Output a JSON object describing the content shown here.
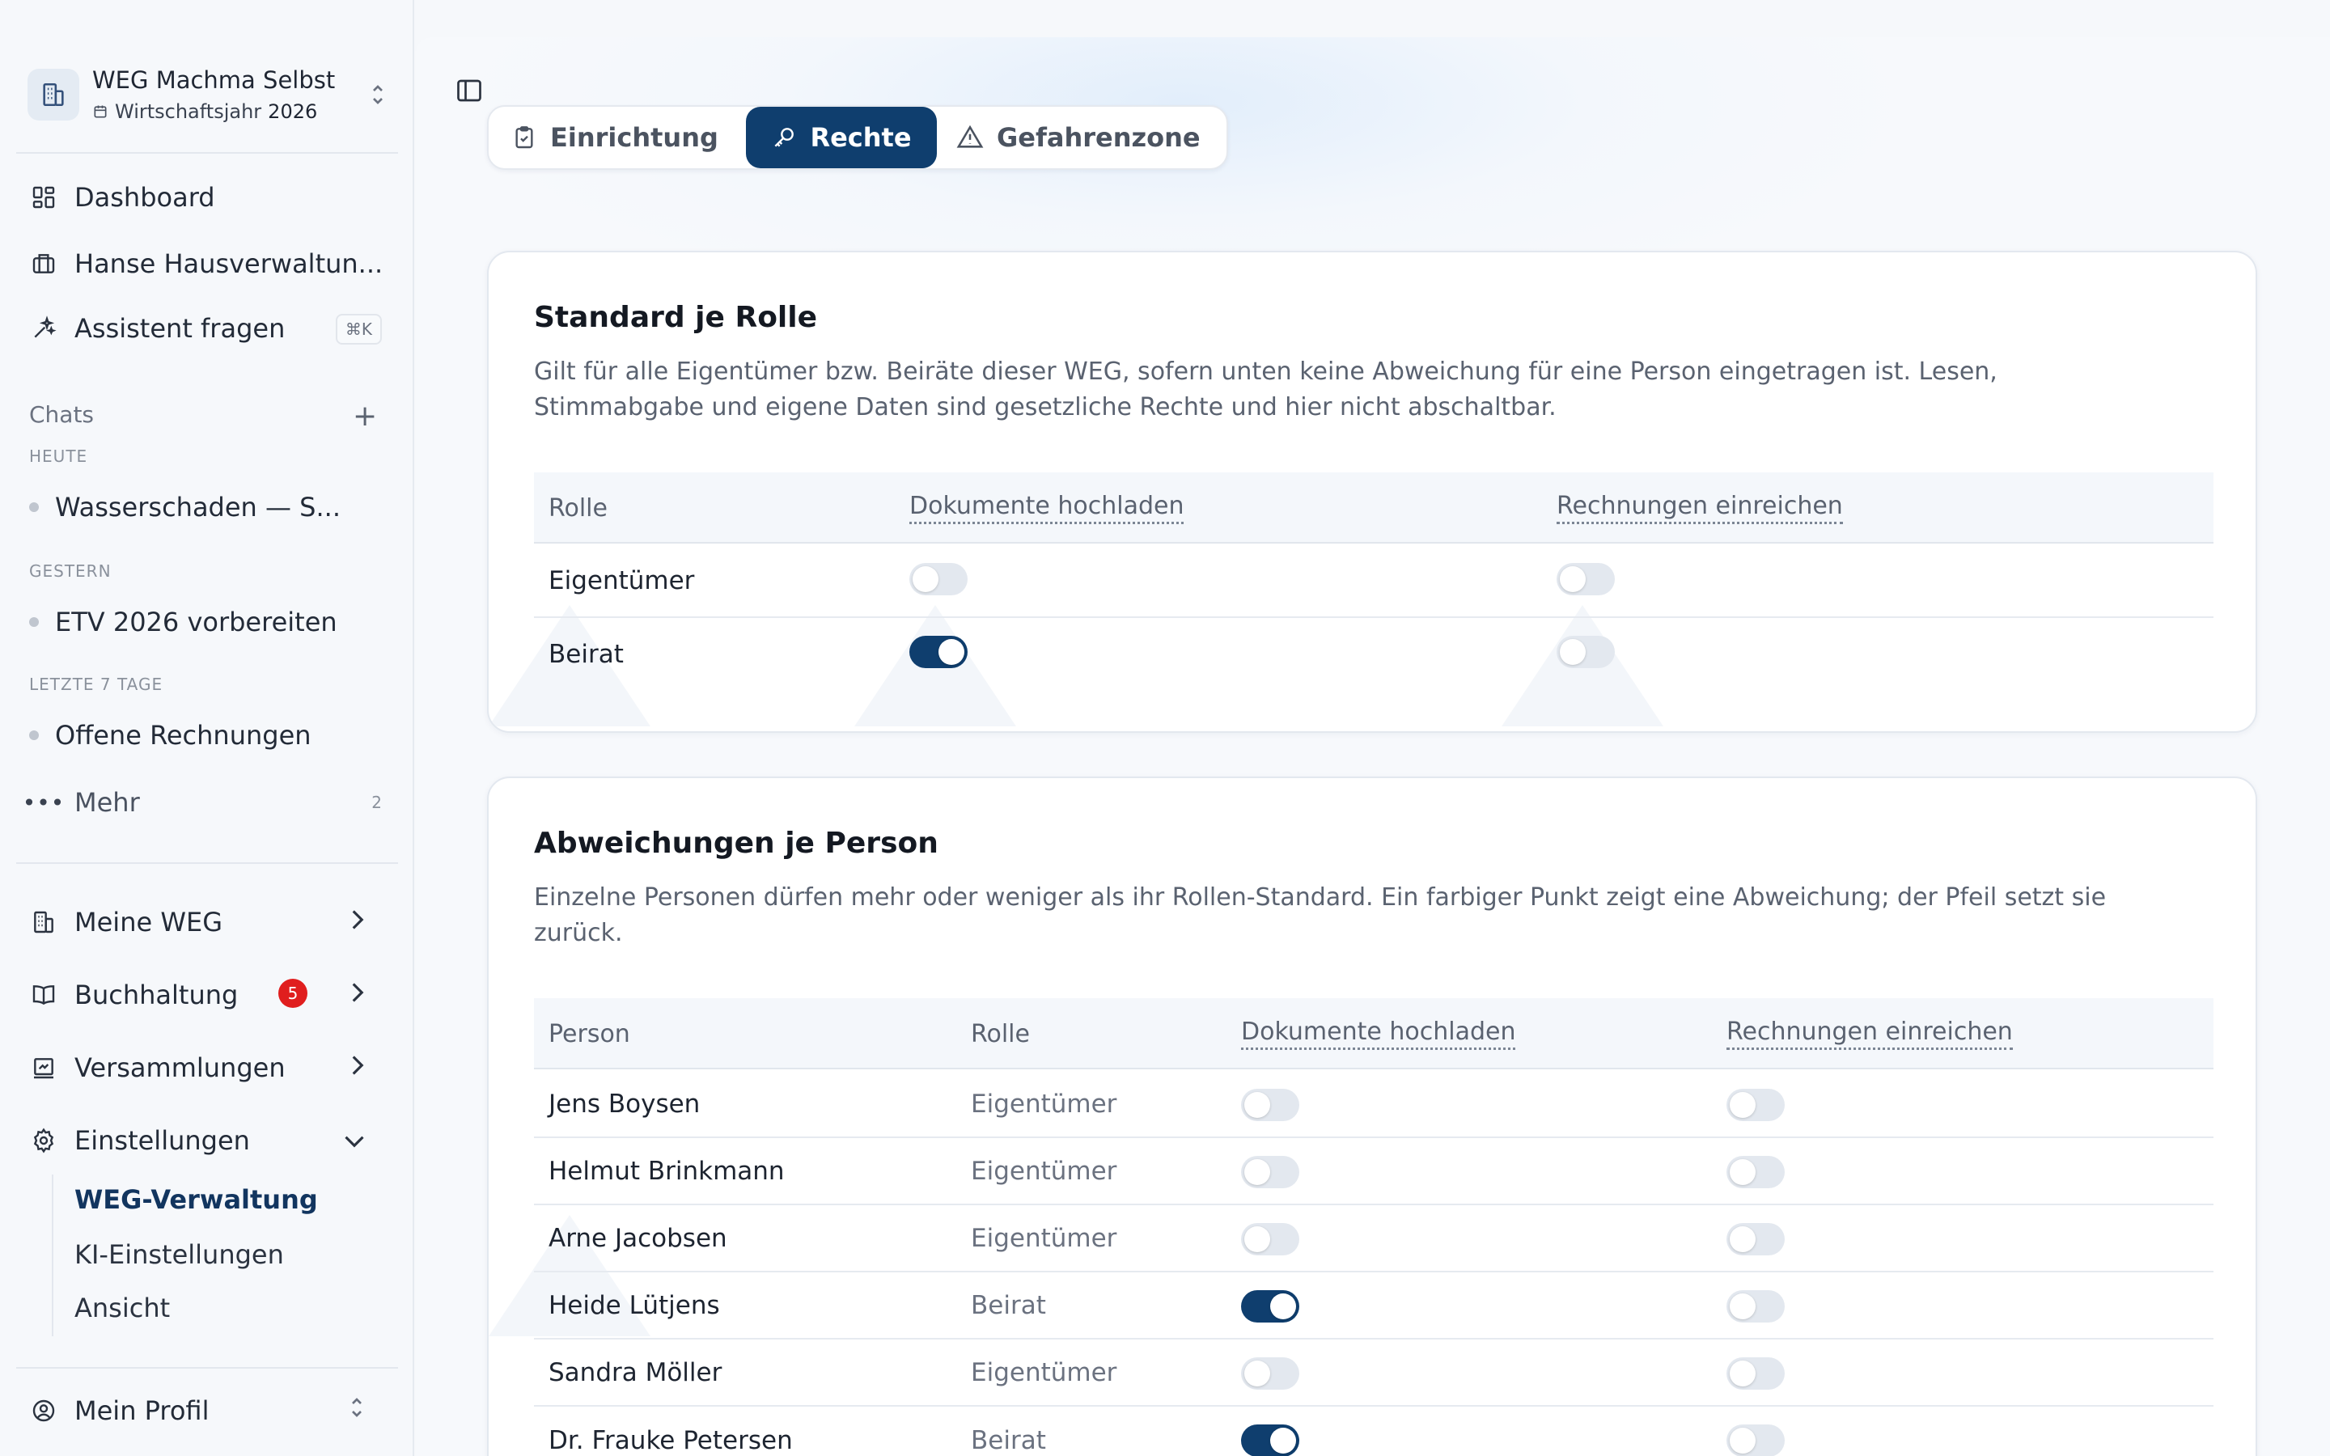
{
  "org": {
    "name": "WEG Machma Selbst",
    "year_label": "Wirtschaftsjahr",
    "year": "2026"
  },
  "nav": {
    "dashboard": "Dashboard",
    "hausverwaltung": "Hanse Hausverwaltun...",
    "assistant": "Assistent fragen",
    "assistant_shortcut": "⌘K"
  },
  "chats": {
    "label": "Chats",
    "today": "HEUTE",
    "yesterday": "GESTERN",
    "last7": "LETZTE 7 TAGE",
    "items": [
      "Wasserschaden — S...",
      "ETV 2026 vorbereiten",
      "Offene Rechnungen"
    ],
    "more": "Mehr",
    "more_count": "2"
  },
  "sections": {
    "meine_weg": "Meine WEG",
    "buchhaltung": "Buchhaltung",
    "buchhaltung_badge": "5",
    "versammlungen": "Versammlungen",
    "einstellungen": "Einstellungen",
    "sub": [
      "WEG-Verwaltung",
      "KI-Einstellungen",
      "Ansicht"
    ],
    "profile": "Mein Profil"
  },
  "tabs": [
    {
      "label": "Einrichtung",
      "active": false
    },
    {
      "label": "Rechte",
      "active": true
    },
    {
      "label": "Gefahrenzone",
      "active": false
    }
  ],
  "standard": {
    "title": "Standard je Rolle",
    "desc_line1": "Gilt für alle Eigentümer bzw. Beiräte dieser WEG, sofern unten keine Abweichung für eine Person eingetragen ist. Lesen,",
    "desc_line2": "Stimmabgabe und eigene Daten sind gesetzliche Rechte und hier nicht abschaltbar.",
    "headers": [
      "Rolle",
      "Dokumente hochladen",
      "Rechnungen einreichen"
    ],
    "rows": [
      {
        "role": "Eigentümer",
        "upload": false,
        "invoice": false
      },
      {
        "role": "Beirat",
        "upload": true,
        "invoice": false
      }
    ]
  },
  "persons": {
    "title": "Abweichungen je Person",
    "desc_line1": "Einzelne Personen dürfen mehr oder weniger als ihr Rollen-Standard. Ein farbiger Punkt zeigt eine Abweichung; der Pfeil setzt sie",
    "desc_line2": "zurück.",
    "headers": [
      "Person",
      "Rolle",
      "Dokumente hochladen",
      "Rechnungen einreichen"
    ],
    "rows": [
      {
        "name": "Jens Boysen",
        "role": "Eigentümer",
        "upload": false,
        "invoice": false
      },
      {
        "name": "Helmut Brinkmann",
        "role": "Eigentümer",
        "upload": false,
        "invoice": false
      },
      {
        "name": "Arne Jacobsen",
        "role": "Eigentümer",
        "upload": false,
        "invoice": false
      },
      {
        "name": "Heide Lütjens",
        "role": "Beirat",
        "upload": true,
        "invoice": false
      },
      {
        "name": "Sandra Möller",
        "role": "Eigentümer",
        "upload": false,
        "invoice": false
      },
      {
        "name": "Dr. Frauke Petersen",
        "role": "Beirat",
        "upload": true,
        "invoice": false
      }
    ]
  },
  "colors": {
    "accent": "#0f3e6e",
    "badge": "#e01e1e",
    "toggle_off": "#e3e8ef"
  }
}
